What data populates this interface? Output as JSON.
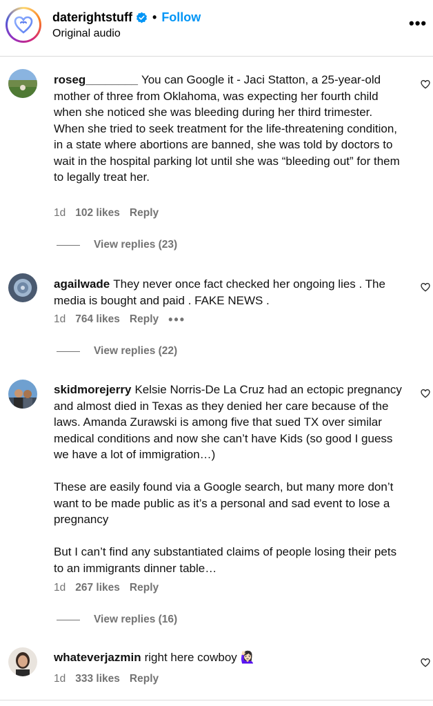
{
  "header": {
    "username": "daterightstuff",
    "dot": "•",
    "follow_label": "Follow",
    "audio_label": "Original audio",
    "more_label": "•••"
  },
  "comments": [
    {
      "username": "roseg________",
      "text": "You can Google it - Jaci Statton, a 25-year-old mother of three from Oklahoma, was expecting her fourth child when she noticed she was bleeding during her third trimester.\nWhen she tried to seek treatment for the life-threatening condition, in a state where abortions are banned, she was told by doctors to wait in the hospital parking lot until she was “bleeding out” for them to legally treat her.",
      "time": "1d",
      "likes": "102 likes",
      "reply": "Reply",
      "view_replies": "View replies (23)"
    },
    {
      "username": "agailwade",
      "text": "They never once fact checked her ongoing lies . The media is bought and paid . FAKE NEWS .",
      "time": "1d",
      "likes": "764 likes",
      "reply": "Reply",
      "more": "•••",
      "view_replies": "View replies (22)"
    },
    {
      "username": "skidmorejerry",
      "text": "Kelsie Norris-De La Cruz had an ectopic pregnancy and almost died in Texas as they denied her care because of the laws. Amanda Zurawski is among five that sued TX over similar medical conditions and now she can’t have Kids (so good I guess we have a lot of immigration…)\n\nThese are easily found via a Google search, but many more don’t want to be made public as it’s a personal and sad event to lose a pregnancy\n\nBut I can’t find any substantiated claims of people losing their pets to an immigrants dinner table…",
      "time": "1d",
      "likes": "267 likes",
      "reply": "Reply",
      "view_replies": "View replies (16)"
    },
    {
      "username": "whateverjazmin",
      "text": "right here cowboy 🙋🏻‍♀️",
      "time": "1d",
      "likes": "333 likes",
      "reply": "Reply"
    }
  ],
  "colors": {
    "accent": "#0095f6",
    "verified": "#0095f6",
    "muted": "#737373",
    "divider": "#dbdbdb"
  },
  "icons": {
    "like": "heart-outline-icon",
    "verified": "verified-badge-icon",
    "more": "more-horizontal-icon"
  }
}
